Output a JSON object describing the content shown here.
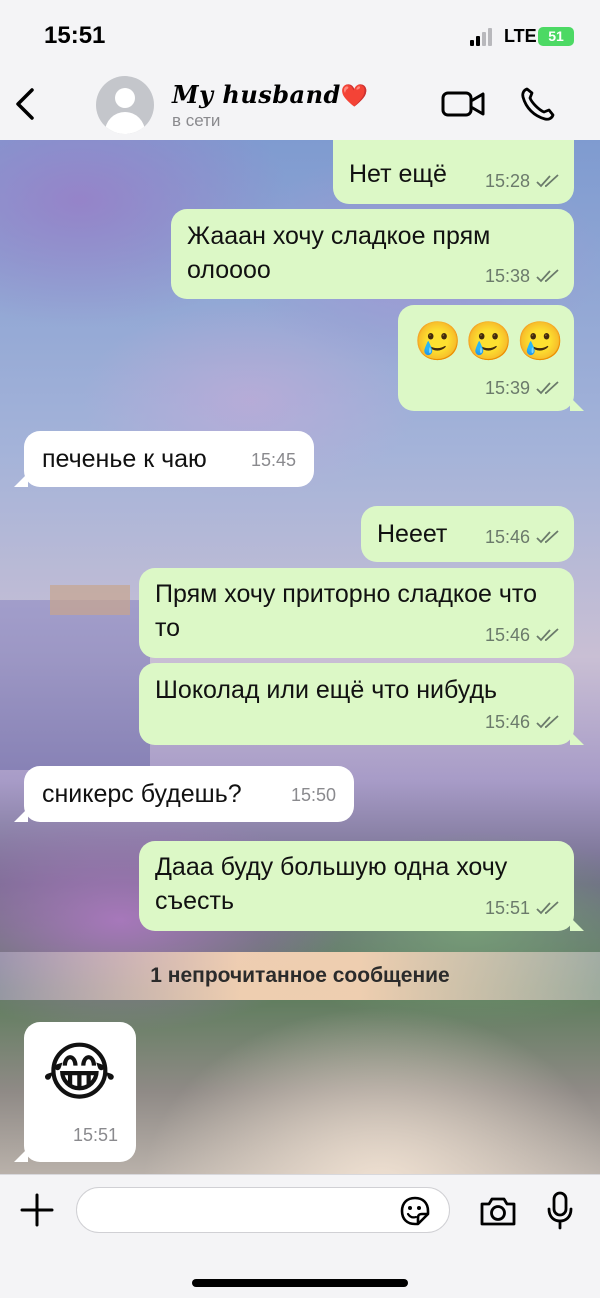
{
  "status_bar": {
    "time": "15:51",
    "network": "LTE",
    "battery": "51"
  },
  "header": {
    "contact_name": "My husband",
    "heart": "❤️",
    "contact_status": "в сети"
  },
  "messages": [
    {
      "type": "out",
      "text": "Нет ещё",
      "time": "15:28"
    },
    {
      "type": "out",
      "text": "Жааан хочу сладкое прям олоооо",
      "time": "15:38"
    },
    {
      "type": "out",
      "text": "🥲🥲🥲",
      "time": "15:39"
    },
    {
      "type": "in",
      "text": "печенье к чаю",
      "time": "15:45"
    },
    {
      "type": "out",
      "text": "Нееет",
      "time": "15:46"
    },
    {
      "type": "out",
      "text": "Прям хочу приторно сладкое что то",
      "time": "15:46"
    },
    {
      "type": "out",
      "text": "Шоколад или ещё что нибудь",
      "time": "15:46"
    },
    {
      "type": "in",
      "text": "сникерс будешь?",
      "time": "15:50"
    },
    {
      "type": "out",
      "text": "Дааа буду большую одна хочу съесть",
      "time": "15:51"
    },
    {
      "type": "in",
      "text": "😂",
      "time": "15:51"
    }
  ],
  "unread_banner": "1 непрочитанное сообщение",
  "input": {
    "placeholder": ""
  },
  "icons": {
    "back": "chevron-left-icon",
    "video": "video-camera-icon",
    "call": "phone-icon",
    "add": "plus-icon",
    "sticker": "sticker-icon",
    "camera": "camera-icon",
    "mic": "microphone-icon",
    "read": "double-check-icon"
  },
  "colors": {
    "outgoing_bubble": "#dcf8c6",
    "incoming_bubble": "#ffffff",
    "battery": "#4cd964"
  }
}
